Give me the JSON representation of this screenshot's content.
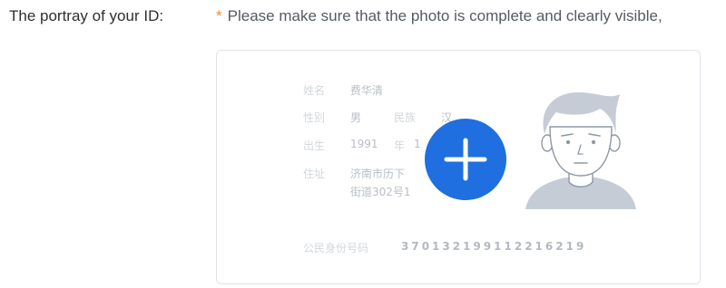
{
  "field": {
    "label": "The portray of your ID:"
  },
  "hint": {
    "star": "*",
    "text": "Please make sure that the photo is complete and clearly visible,"
  },
  "id_card": {
    "name_label": "姓名",
    "name_value": "费华清",
    "gender_label": "性别",
    "gender_value": "男",
    "ethnicity_label": "民族",
    "ethnicity_value": "汉",
    "birth_label": "出生",
    "birth_year": "1991",
    "birth_year_unit": "年",
    "birth_rest": "1",
    "address_label": "住址",
    "address_line1": "济南市历下",
    "address_line2": "街道302号1",
    "id_number_label": "公民身份号码",
    "id_number_value": "370132199112216219"
  },
  "upload": {
    "button_icon": "plus-icon",
    "accent_color": "#1f6fe0"
  },
  "icons": {
    "avatar": "person-silhouette-icon"
  }
}
